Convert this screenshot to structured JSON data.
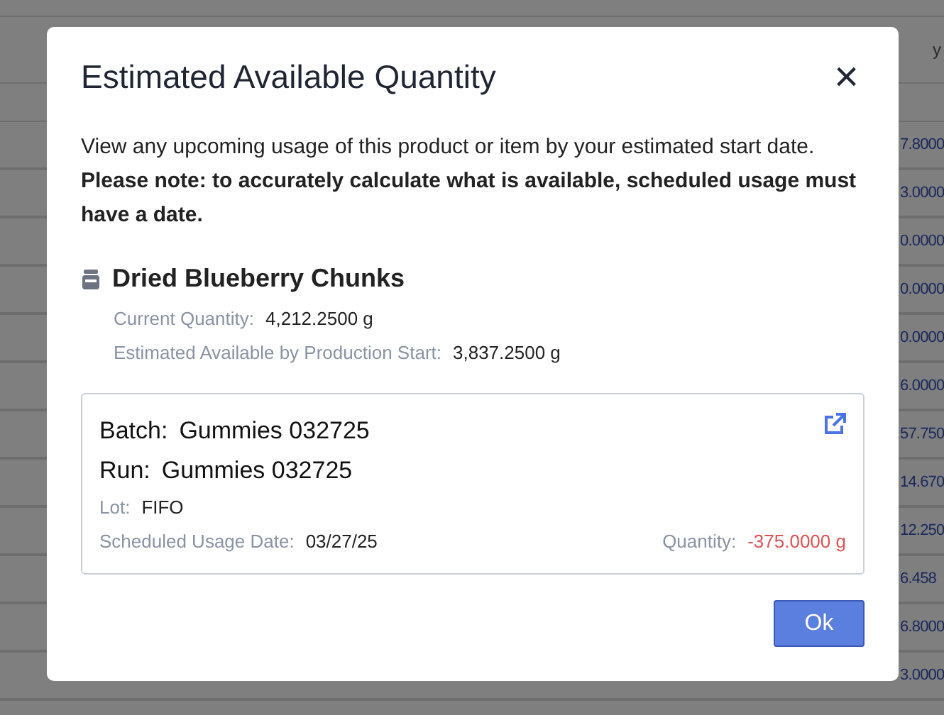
{
  "background_table": {
    "header": "y",
    "values": [
      "7.8000",
      "3.0000",
      "0.0000",
      "0.0000",
      "0.0000",
      "6.0000",
      "57.750",
      "14.670",
      "12.250",
      "6.458",
      "6.8000",
      "3.0000"
    ]
  },
  "dialog": {
    "title": "Estimated Available Quantity",
    "close": "×",
    "description": "View any upcoming usage of this product or item by your estimated start date. **Please note: to accurately calculate what is available, scheduled usage must have a date.**",
    "product": {
      "name": "Dried Blueberry Chunks",
      "details": [
        {
          "label": "Current Quantity:",
          "value": "4,212.2500 g"
        },
        {
          "label": "Estimated Available by Production Start:",
          "value": "3,837.2500 g"
        }
      ]
    },
    "usages": [
      {
        "batch_label": "Batch:",
        "batch": "Gummies 032725",
        "run_label": "Run:",
        "run": "Gummies 032725",
        "lot_label": "Lot:",
        "lot": "FIFO",
        "date_label": "Scheduled Usage Date:",
        "date": "03/27/25",
        "quantity_label": "Quantity:",
        "quantity": "-375.0000 g",
        "negative": true
      }
    ],
    "ok_button": "Ok"
  }
}
